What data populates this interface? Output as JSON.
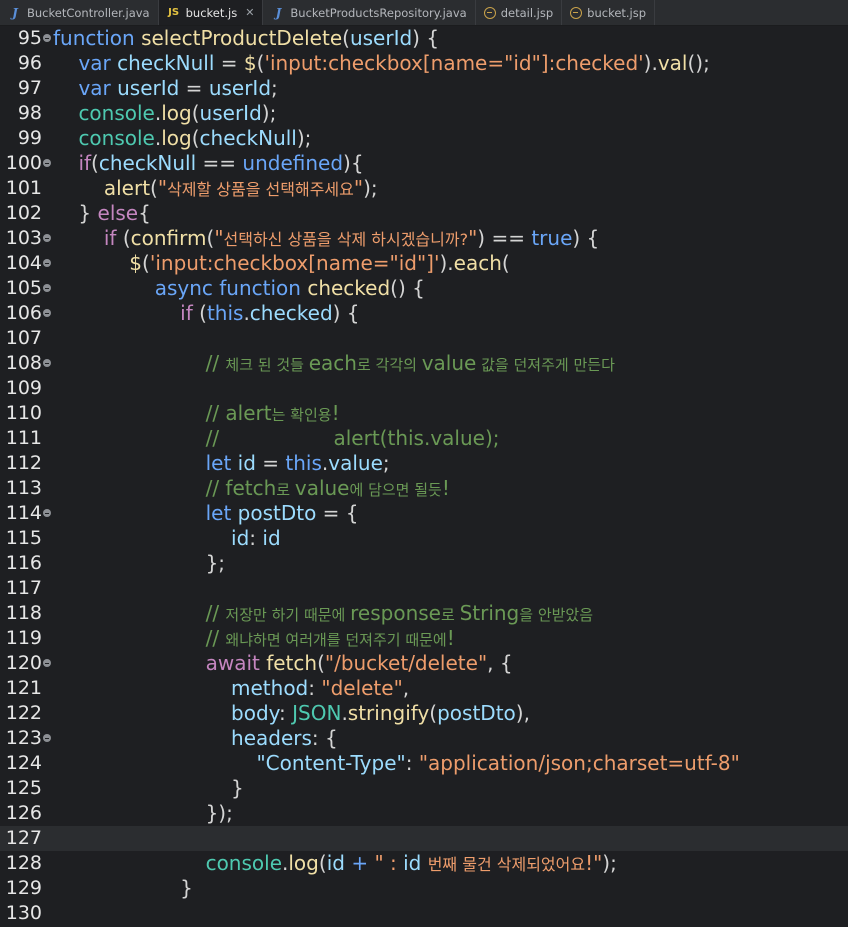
{
  "tabs": [
    {
      "label": "BucketController.java",
      "icon": "java-file-icon",
      "active": false
    },
    {
      "label": "bucket.js",
      "icon": "js-file-icon",
      "active": true
    },
    {
      "label": "BucketProductsRepository.java",
      "icon": "java-file-icon",
      "active": false
    },
    {
      "label": "detail.jsp",
      "icon": "jsp-file-icon",
      "active": false
    },
    {
      "label": "bucket.jsp",
      "icon": "jsp-file-icon",
      "active": false
    }
  ],
  "editor": {
    "current_line": 127,
    "lines": [
      {
        "n": "95",
        "fold": true,
        "tokens": [
          [
            "k",
            "function "
          ],
          [
            "f",
            "selectProductDelete"
          ],
          [
            "p",
            "("
          ],
          [
            "v",
            "userId"
          ],
          [
            "p",
            ") {"
          ]
        ]
      },
      {
        "n": "96",
        "fold": false,
        "tokens": [
          [
            "p",
            "    "
          ],
          [
            "k",
            "var "
          ],
          [
            "v",
            "checkNull"
          ],
          [
            "p",
            " = "
          ],
          [
            "f",
            "$"
          ],
          [
            "p",
            "("
          ],
          [
            "s",
            "'input:checkbox[name=\"id\"]:checked'"
          ],
          [
            "p",
            ")."
          ],
          [
            "f",
            "val"
          ],
          [
            "p",
            "();"
          ]
        ]
      },
      {
        "n": "97",
        "fold": false,
        "tokens": [
          [
            "p",
            "    "
          ],
          [
            "k",
            "var "
          ],
          [
            "v",
            "userId"
          ],
          [
            "p",
            " = "
          ],
          [
            "v",
            "userId"
          ],
          [
            "p",
            ";"
          ]
        ]
      },
      {
        "n": "98",
        "fold": false,
        "tokens": [
          [
            "p",
            "    "
          ],
          [
            "t",
            "console"
          ],
          [
            "p",
            "."
          ],
          [
            "f",
            "log"
          ],
          [
            "p",
            "("
          ],
          [
            "v",
            "userId"
          ],
          [
            "p",
            ");"
          ]
        ]
      },
      {
        "n": "99",
        "fold": false,
        "tokens": [
          [
            "p",
            "    "
          ],
          [
            "t",
            "console"
          ],
          [
            "p",
            "."
          ],
          [
            "f",
            "log"
          ],
          [
            "p",
            "("
          ],
          [
            "v",
            "checkNull"
          ],
          [
            "p",
            ");"
          ]
        ]
      },
      {
        "n": "100",
        "fold": true,
        "tokens": [
          [
            "p",
            "    "
          ],
          [
            "kw",
            "if"
          ],
          [
            "p",
            "("
          ],
          [
            "v",
            "checkNull"
          ],
          [
            "p",
            " == "
          ],
          [
            "k",
            "undefined"
          ],
          [
            "p",
            "){"
          ]
        ]
      },
      {
        "n": "101",
        "fold": false,
        "tokens": [
          [
            "p",
            "        "
          ],
          [
            "f",
            "alert"
          ],
          [
            "p",
            "("
          ],
          [
            "s",
            "\""
          ],
          [
            "sk",
            "삭제할 상품을 선택해주세요"
          ],
          [
            "s",
            "\""
          ],
          [
            "p",
            ");"
          ]
        ]
      },
      {
        "n": "102",
        "fold": false,
        "tokens": [
          [
            "p",
            "    } "
          ],
          [
            "kw",
            "else"
          ],
          [
            "p",
            "{"
          ]
        ]
      },
      {
        "n": "103",
        "fold": true,
        "tokens": [
          [
            "p",
            "        "
          ],
          [
            "kw",
            "if "
          ],
          [
            "p",
            "("
          ],
          [
            "f",
            "confirm"
          ],
          [
            "p",
            "("
          ],
          [
            "s",
            "\""
          ],
          [
            "sk",
            "선택하신 상품을 삭제 하시겠습니까?"
          ],
          [
            "s",
            "\""
          ],
          [
            "p",
            ") == "
          ],
          [
            "k",
            "true"
          ],
          [
            "p",
            ") {"
          ]
        ]
      },
      {
        "n": "104",
        "fold": true,
        "tokens": [
          [
            "p",
            "            "
          ],
          [
            "f",
            "$"
          ],
          [
            "p",
            "("
          ],
          [
            "s",
            "'input:checkbox[name=\"id\"]'"
          ],
          [
            "p",
            ")."
          ],
          [
            "f",
            "each"
          ],
          [
            "p",
            "("
          ]
        ]
      },
      {
        "n": "105",
        "fold": true,
        "tokens": [
          [
            "p",
            "                "
          ],
          [
            "k",
            "async function "
          ],
          [
            "f",
            "checked"
          ],
          [
            "p",
            "() {"
          ]
        ]
      },
      {
        "n": "106",
        "fold": true,
        "tokens": [
          [
            "p",
            "                    "
          ],
          [
            "kw",
            "if "
          ],
          [
            "p",
            "("
          ],
          [
            "k",
            "this"
          ],
          [
            "p",
            "."
          ],
          [
            "v",
            "checked"
          ],
          [
            "p",
            ") {"
          ]
        ]
      },
      {
        "n": "107",
        "fold": false,
        "tokens": []
      },
      {
        "n": "108",
        "fold": true,
        "tokens": [
          [
            "p",
            "                        "
          ],
          [
            "c",
            "// "
          ],
          [
            "ck",
            "체크 된 것들 "
          ],
          [
            "c",
            "each"
          ],
          [
            "ck",
            "로 각각의 "
          ],
          [
            "c",
            "value"
          ],
          [
            "ck",
            " 값을 던져주게 만든다"
          ]
        ]
      },
      {
        "n": "109",
        "fold": false,
        "tokens": []
      },
      {
        "n": "110",
        "fold": false,
        "tokens": [
          [
            "p",
            "                        "
          ],
          [
            "c",
            "// alert"
          ],
          [
            "ck",
            "는 확인용"
          ],
          [
            "c",
            "!"
          ]
        ]
      },
      {
        "n": "111",
        "fold": false,
        "tokens": [
          [
            "p",
            "                        "
          ],
          [
            "c",
            "//                  alert(this.value);"
          ]
        ]
      },
      {
        "n": "112",
        "fold": false,
        "tokens": [
          [
            "p",
            "                        "
          ],
          [
            "k",
            "let "
          ],
          [
            "v",
            "id"
          ],
          [
            "p",
            " = "
          ],
          [
            "k",
            "this"
          ],
          [
            "p",
            "."
          ],
          [
            "v",
            "value"
          ],
          [
            "p",
            ";"
          ]
        ]
      },
      {
        "n": "113",
        "fold": false,
        "tokens": [
          [
            "p",
            "                        "
          ],
          [
            "c",
            "// fetch"
          ],
          [
            "ck",
            "로 "
          ],
          [
            "c",
            "value"
          ],
          [
            "ck",
            "에 담으면 될듯"
          ],
          [
            "c",
            "!"
          ]
        ]
      },
      {
        "n": "114",
        "fold": true,
        "tokens": [
          [
            "p",
            "                        "
          ],
          [
            "k",
            "let "
          ],
          [
            "v",
            "postDto"
          ],
          [
            "p",
            " = {"
          ]
        ]
      },
      {
        "n": "115",
        "fold": false,
        "tokens": [
          [
            "p",
            "                            "
          ],
          [
            "v",
            "id"
          ],
          [
            "p",
            ": "
          ],
          [
            "v",
            "id"
          ]
        ]
      },
      {
        "n": "116",
        "fold": false,
        "tokens": [
          [
            "p",
            "                        };"
          ]
        ]
      },
      {
        "n": "117",
        "fold": false,
        "tokens": []
      },
      {
        "n": "118",
        "fold": false,
        "tokens": [
          [
            "p",
            "                        "
          ],
          [
            "c",
            "// "
          ],
          [
            "ck",
            "저장만 하기 때문에 "
          ],
          [
            "c",
            "response"
          ],
          [
            "ck",
            "로 "
          ],
          [
            "c",
            "String"
          ],
          [
            "ck",
            "을 안받았음"
          ]
        ]
      },
      {
        "n": "119",
        "fold": false,
        "tokens": [
          [
            "p",
            "                        "
          ],
          [
            "c",
            "// "
          ],
          [
            "ck",
            "왜냐하면 여러개를 던져주기 때문에"
          ],
          [
            "c",
            "!"
          ]
        ]
      },
      {
        "n": "120",
        "fold": true,
        "tokens": [
          [
            "p",
            "                        "
          ],
          [
            "kw",
            "await "
          ],
          [
            "f",
            "fetch"
          ],
          [
            "p",
            "("
          ],
          [
            "s",
            "\"/bucket/delete\""
          ],
          [
            "p",
            ", {"
          ]
        ]
      },
      {
        "n": "121",
        "fold": false,
        "tokens": [
          [
            "p",
            "                            "
          ],
          [
            "v",
            "method"
          ],
          [
            "p",
            ": "
          ],
          [
            "s",
            "\"delete\""
          ],
          [
            "p",
            ","
          ]
        ]
      },
      {
        "n": "122",
        "fold": false,
        "tokens": [
          [
            "p",
            "                            "
          ],
          [
            "v",
            "body"
          ],
          [
            "p",
            ": "
          ],
          [
            "t",
            "JSON"
          ],
          [
            "p",
            "."
          ],
          [
            "f",
            "stringify"
          ],
          [
            "p",
            "("
          ],
          [
            "v",
            "postDto"
          ],
          [
            "p",
            "),"
          ]
        ]
      },
      {
        "n": "123",
        "fold": true,
        "tokens": [
          [
            "p",
            "                            "
          ],
          [
            "v",
            "headers"
          ],
          [
            "p",
            ": {"
          ]
        ]
      },
      {
        "n": "124",
        "fold": false,
        "tokens": [
          [
            "p",
            "                                "
          ],
          [
            "v",
            "\"Content-Type\""
          ],
          [
            "p",
            ": "
          ],
          [
            "s",
            "\"application/json;charset=utf-8\""
          ]
        ]
      },
      {
        "n": "125",
        "fold": false,
        "tokens": [
          [
            "p",
            "                            }"
          ]
        ]
      },
      {
        "n": "126",
        "fold": false,
        "tokens": [
          [
            "p",
            "                        });"
          ]
        ]
      },
      {
        "n": "127",
        "fold": false,
        "tokens": []
      },
      {
        "n": "128",
        "fold": false,
        "tokens": [
          [
            "p",
            "                        "
          ],
          [
            "t",
            "console"
          ],
          [
            "p",
            "."
          ],
          [
            "f",
            "log"
          ],
          [
            "p",
            "("
          ],
          [
            "v",
            "id"
          ],
          [
            "p",
            " "
          ],
          [
            "k",
            "+"
          ],
          [
            "p",
            " "
          ],
          [
            "s",
            "\" : "
          ],
          [
            "v",
            "id "
          ],
          [
            "sk",
            "번째 물건 삭제되었어요"
          ],
          [
            "s",
            "!\""
          ],
          [
            "p",
            ");"
          ]
        ]
      },
      {
        "n": "129",
        "fold": false,
        "tokens": [
          [
            "p",
            "                    }"
          ]
        ]
      },
      {
        "n": "130",
        "fold": false,
        "tokens": []
      }
    ]
  }
}
